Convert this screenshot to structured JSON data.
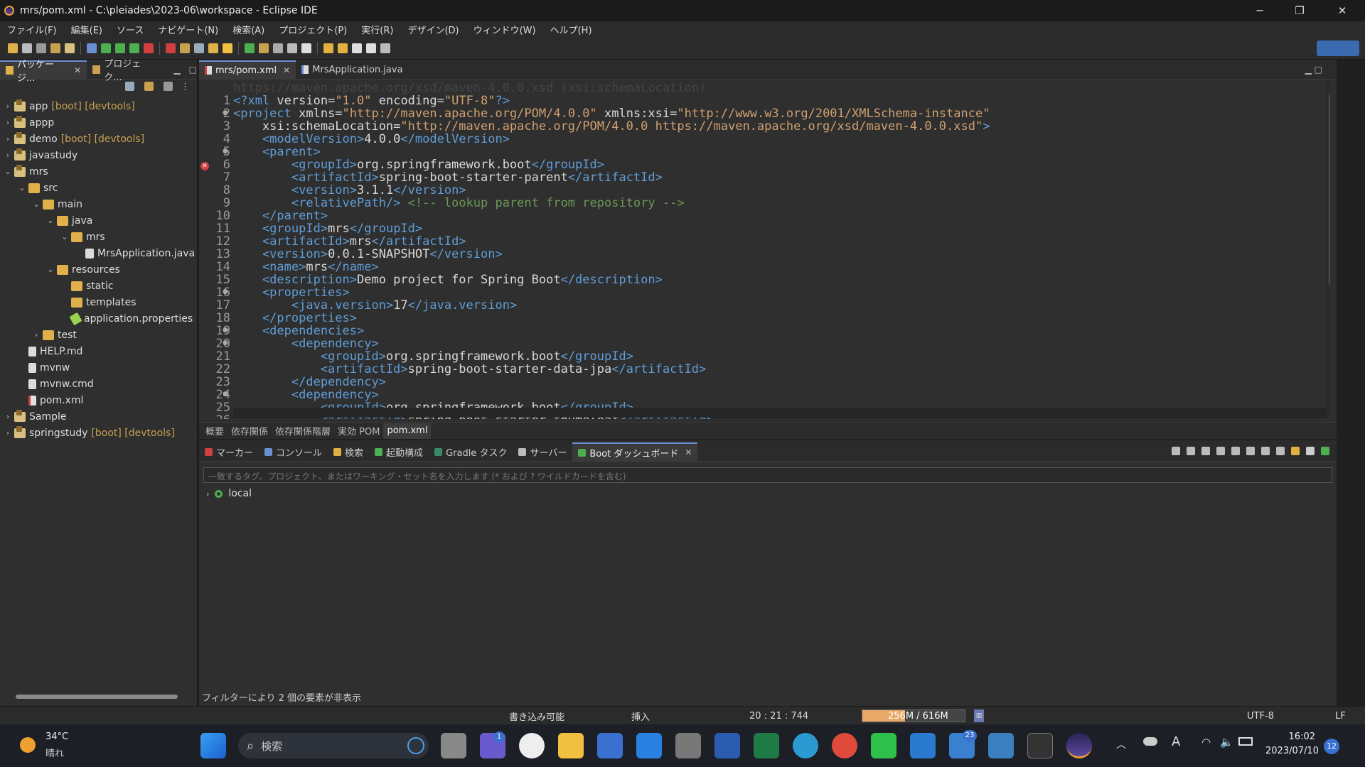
{
  "window": {
    "title": "mrs/pom.xml - C:\\pleiades\\2023-06\\workspace - Eclipse IDE",
    "minimize": "─",
    "maximize": "❐",
    "close": "✕"
  },
  "menu": [
    "ファイル(F)",
    "編集(E)",
    "ソース",
    "ナビゲート(N)",
    "検索(A)",
    "プロジェクト(P)",
    "実行(R)",
    "デザイン(D)",
    "ウィンドウ(W)",
    "ヘルプ(H)"
  ],
  "left_tabs": [
    "パッケージ...",
    "プロジェク..."
  ],
  "tree": [
    {
      "label": "app",
      "deco": "[boot] [devtools]",
      "type": "proj",
      "depth": 0,
      "arrow": "›"
    },
    {
      "label": "appp",
      "deco": "",
      "type": "proj",
      "depth": 0,
      "arrow": "›"
    },
    {
      "label": "demo",
      "deco": "[boot] [devtools]",
      "type": "proj",
      "depth": 0,
      "arrow": "›"
    },
    {
      "label": "javastudy",
      "deco": "",
      "type": "proj",
      "depth": 0,
      "arrow": "›"
    },
    {
      "label": "mrs",
      "deco": "",
      "type": "proj",
      "depth": 0,
      "arrow": "⌄"
    },
    {
      "label": "src",
      "deco": "",
      "type": "folder",
      "depth": 1,
      "arrow": "⌄"
    },
    {
      "label": "main",
      "deco": "",
      "type": "folder",
      "depth": 2,
      "arrow": "⌄"
    },
    {
      "label": "java",
      "deco": "",
      "type": "folder",
      "depth": 3,
      "arrow": "⌄"
    },
    {
      "label": "mrs",
      "deco": "",
      "type": "folder",
      "depth": 4,
      "arrow": "⌄"
    },
    {
      "label": "MrsApplication.java",
      "deco": "",
      "type": "java",
      "depth": 5,
      "arrow": ""
    },
    {
      "label": "resources",
      "deco": "",
      "type": "folder",
      "depth": 3,
      "arrow": "⌄"
    },
    {
      "label": "static",
      "deco": "",
      "type": "folder",
      "depth": 4,
      "arrow": ""
    },
    {
      "label": "templates",
      "deco": "",
      "type": "folder",
      "depth": 4,
      "arrow": ""
    },
    {
      "label": "application.properties",
      "deco": "",
      "type": "prop",
      "depth": 4,
      "arrow": ""
    },
    {
      "label": "test",
      "deco": "",
      "type": "folder",
      "depth": 2,
      "arrow": "›"
    },
    {
      "label": "HELP.md",
      "deco": "",
      "type": "file",
      "depth": 1,
      "arrow": ""
    },
    {
      "label": "mvnw",
      "deco": "",
      "type": "file",
      "depth": 1,
      "arrow": ""
    },
    {
      "label": "mvnw.cmd",
      "deco": "",
      "type": "file",
      "depth": 1,
      "arrow": ""
    },
    {
      "label": "pom.xml",
      "deco": "",
      "type": "xml",
      "depth": 1,
      "arrow": ""
    },
    {
      "label": "Sample",
      "deco": "",
      "type": "proj",
      "depth": 0,
      "arrow": "›"
    },
    {
      "label": "springstudy",
      "deco": "[boot] [devtools]",
      "type": "proj",
      "depth": 0,
      "arrow": "›"
    }
  ],
  "editor_tabs": [
    {
      "label": "mrs/pom.xml",
      "active": true
    },
    {
      "label": "MrsApplication.java",
      "active": false
    }
  ],
  "hover_ghost": "https://maven.apache.org/xsd/maven-4.0.0.xsd (xsi:schemaLocation)",
  "code": [
    {
      "n": "1",
      "m": "",
      "t": [
        [
          "tag",
          "<?xml "
        ],
        [
          "txt",
          "version="
        ],
        [
          "str",
          "\"1.0\""
        ],
        [
          "txt",
          " encoding="
        ],
        [
          "str",
          "\"UTF-8\""
        ],
        [
          "tag",
          "?>"
        ]
      ]
    },
    {
      "n": "2",
      "m": "●",
      "t": [
        [
          "tag",
          "<project "
        ],
        [
          "txt",
          "xmlns="
        ],
        [
          "str",
          "\"http://maven.apache.org/POM/4.0.0\""
        ],
        [
          "txt",
          " xmlns:xsi="
        ],
        [
          "str",
          "\"http://www.w3.org/2001/XMLSchema-instance\""
        ]
      ]
    },
    {
      "n": "3",
      "m": "",
      "t": [
        [
          "txt",
          "    xsi:schemaLocation="
        ],
        [
          "str",
          "\"http://maven.apache.org/POM/4.0.0 https://maven.apache.org/xsd/maven-4.0.0.xsd\""
        ],
        [
          "tag",
          ">"
        ]
      ]
    },
    {
      "n": "4",
      "m": "",
      "t": [
        [
          "tag",
          "    <modelVersion>"
        ],
        [
          "txt",
          "4.0.0"
        ],
        [
          "tag",
          "</modelVersion>"
        ]
      ]
    },
    {
      "n": "5",
      "m": "●",
      "t": [
        [
          "tag",
          "    <parent>"
        ]
      ]
    },
    {
      "n": "6",
      "m": "",
      "t": [
        [
          "tag",
          "        <groupId>"
        ],
        [
          "txt",
          "org.springframework.boot"
        ],
        [
          "tag",
          "</groupId>"
        ]
      ]
    },
    {
      "n": "7",
      "m": "",
      "t": [
        [
          "tag",
          "        <artifactId>"
        ],
        [
          "txt",
          "spring-boot-starter-parent"
        ],
        [
          "tag",
          "</artifactId>"
        ]
      ]
    },
    {
      "n": "8",
      "m": "",
      "t": [
        [
          "tag",
          "        <version>"
        ],
        [
          "txt",
          "3.1.1"
        ],
        [
          "tag",
          "</version>"
        ]
      ]
    },
    {
      "n": "9",
      "m": "",
      "t": [
        [
          "tag",
          "        <relativePath/> "
        ],
        [
          "com",
          "<!-- lookup parent from repository -->"
        ]
      ]
    },
    {
      "n": "10",
      "m": "",
      "t": [
        [
          "tag",
          "    </parent>"
        ]
      ]
    },
    {
      "n": "11",
      "m": "",
      "t": [
        [
          "tag",
          "    <groupId>"
        ],
        [
          "txt",
          "mrs"
        ],
        [
          "tag",
          "</groupId>"
        ]
      ]
    },
    {
      "n": "12",
      "m": "",
      "t": [
        [
          "tag",
          "    <artifactId>"
        ],
        [
          "txt",
          "mrs"
        ],
        [
          "tag",
          "</artifactId>"
        ]
      ]
    },
    {
      "n": "13",
      "m": "",
      "t": [
        [
          "tag",
          "    <version>"
        ],
        [
          "txt",
          "0.0.1-SNAPSHOT"
        ],
        [
          "tag",
          "</version>"
        ]
      ]
    },
    {
      "n": "14",
      "m": "",
      "t": [
        [
          "tag",
          "    <name>"
        ],
        [
          "txt",
          "mrs"
        ],
        [
          "tag",
          "</name>"
        ]
      ]
    },
    {
      "n": "15",
      "m": "",
      "t": [
        [
          "tag",
          "    <description>"
        ],
        [
          "txt",
          "Demo project for Spring Boot"
        ],
        [
          "tag",
          "</description>"
        ]
      ]
    },
    {
      "n": "16",
      "m": "●",
      "t": [
        [
          "tag",
          "    <properties>"
        ]
      ]
    },
    {
      "n": "17",
      "m": "",
      "t": [
        [
          "tag",
          "        <java.version>"
        ],
        [
          "txt",
          "17"
        ],
        [
          "tag",
          "</java.version>"
        ]
      ]
    },
    {
      "n": "18",
      "m": "",
      "t": [
        [
          "tag",
          "    </properties>"
        ]
      ]
    },
    {
      "n": "19",
      "m": "●",
      "t": [
        [
          "tag",
          "    <dependencies>"
        ]
      ]
    },
    {
      "n": "20",
      "m": "●",
      "t": [
        [
          "tag",
          "        <dependency>"
        ]
      ]
    },
    {
      "n": "21",
      "m": "",
      "t": [
        [
          "tag",
          "            <groupId>"
        ],
        [
          "txt",
          "org.springframework.boot"
        ],
        [
          "tag",
          "</groupId>"
        ]
      ]
    },
    {
      "n": "22",
      "m": "",
      "t": [
        [
          "tag",
          "            <artifactId>"
        ],
        [
          "txt",
          "spring-boot-starter-data-jpa"
        ],
        [
          "tag",
          "</artifactId>"
        ]
      ]
    },
    {
      "n": "23",
      "m": "",
      "t": [
        [
          "tag",
          "        </dependency>"
        ]
      ]
    },
    {
      "n": "24",
      "m": "●",
      "t": [
        [
          "tag",
          "        <dependency>"
        ]
      ]
    },
    {
      "n": "25",
      "m": "",
      "t": [
        [
          "tag",
          "            <groupId>"
        ],
        [
          "txt",
          "org.springframework.boot"
        ],
        [
          "tag",
          "</groupId>"
        ]
      ]
    },
    {
      "n": "26",
      "m": "",
      "t": [
        [
          "tag",
          "            <artifactId>"
        ],
        [
          "txt",
          "spring-boot-starter-thymeleaf"
        ],
        [
          "tag",
          "</artifactId>"
        ]
      ]
    }
  ],
  "pom_tabs": [
    {
      "label": "概要",
      "active": false
    },
    {
      "label": "依存関係",
      "active": false
    },
    {
      "label": "依存関係階層",
      "active": false
    },
    {
      "label": "実効 POM",
      "active": false
    },
    {
      "label": "pom.xml",
      "active": true
    }
  ],
  "bottom_tabs": [
    "マーカー",
    "コンソール",
    "検索",
    "起動構成",
    "Gradle タスク",
    "サーバー",
    "Boot ダッシュボード"
  ],
  "filter_placeholder": "一致するタグ、プロジェクト、またはワーキング・セット名を入力します (* および ? ワイルドカードを含む)",
  "local_label": "local",
  "hidden_note": "フィルターにより 2 個の要素が非表示",
  "status": {
    "writable": "書き込み可能",
    "insert": "挿入",
    "position": "20 : 21 : 744",
    "heap": "256M / 616M",
    "heap_fraction": 0.42,
    "encoding": "UTF-8",
    "line_end": "LF"
  },
  "taskbar": {
    "temp": "34°C",
    "weather": "晴れ",
    "search": "検索",
    "time": "16:02",
    "date": "2023/07/10",
    "notif": "12",
    "teams_badge": "1",
    "mail_badge": "23"
  }
}
